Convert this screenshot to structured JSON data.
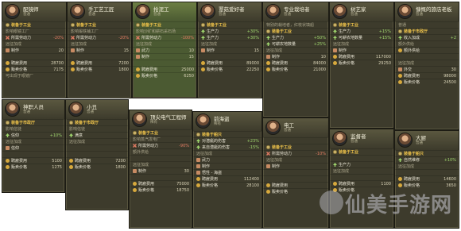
{
  "colors": {
    "card_bg": "#3d3b2c",
    "card_green": "#4b5a32",
    "accent_gold": "#f0c44a",
    "negative": "#e07b62",
    "positive": "#9ed46d"
  },
  "cards": {
    "c1": {
      "title": "配镜师",
      "subtitle": "普通",
      "rows": [
        {
          "icon": "gear",
          "label": "装备于工业",
          "value": ""
        },
        {
          "icon": "",
          "label": "影响眼镜工厂",
          "value": ""
        },
        {
          "icon": "cross",
          "label": "所需劳动力",
          "value": "-20%"
        },
        {
          "icon": "",
          "label": "远征加成",
          "value": ""
        },
        {
          "icon": "fist",
          "label": "制作",
          "value": "20"
        },
        {
          "icon": "",
          "label": "",
          "value": ""
        },
        {
          "icon": "coin",
          "label": "聘雇费用",
          "value": "28700"
        },
        {
          "icon": "coin",
          "label": "贩卖价格",
          "value": "7175"
        },
        {
          "icon": "",
          "label": "可出现于眼镜厂",
          "value": ""
        }
      ]
    },
    "c2": {
      "title": "手工艺工匠",
      "subtitle": "普通",
      "rows": [
        {
          "icon": "gear",
          "label": "装备于工业",
          "value": ""
        },
        {
          "icon": "",
          "label": "影响锻铁铺工厂",
          "value": ""
        },
        {
          "icon": "cross",
          "label": "所需劳动力",
          "value": "-20%"
        },
        {
          "icon": "",
          "label": "远征加成",
          "value": ""
        },
        {
          "icon": "fist",
          "label": "制作",
          "value": "15"
        },
        {
          "icon": "",
          "label": "",
          "value": ""
        },
        {
          "icon": "coin",
          "label": "聘雇费用",
          "value": "7200"
        },
        {
          "icon": "coin",
          "label": "贩卖价格",
          "value": "1800"
        }
      ]
    },
    "c3": {
      "title": "抢泥工",
      "subtitle": "普通",
      "rows": [
        {
          "icon": "gear",
          "label": "装备于工业",
          "value": ""
        },
        {
          "icon": "",
          "label": "影响沙矿和耕石采石场",
          "value": ""
        },
        {
          "icon": "cross",
          "label": "所需劳动力",
          "value": "-100%"
        },
        {
          "icon": "",
          "label": "远征加成",
          "value": ""
        },
        {
          "icon": "fist",
          "label": "武力",
          "value": "10"
        },
        {
          "icon": "fist",
          "label": "制作",
          "value": "15"
        },
        {
          "icon": "",
          "label": "",
          "value": ""
        },
        {
          "icon": "coin",
          "label": "聘雇费用",
          "value": "25000"
        },
        {
          "icon": "coin",
          "label": "贩卖价格",
          "value": "6250"
        }
      ]
    },
    "c4": {
      "title": "蕈菇爱好者",
      "subtitle": "普通",
      "rows": [
        {
          "icon": "gear",
          "label": "装备于工业",
          "value": ""
        },
        {
          "icon": "arrow",
          "label": "生产力",
          "value": "+30%"
        },
        {
          "icon": "arrow",
          "label": "生产力",
          "value": "+30%"
        },
        {
          "icon": "",
          "label": "远征加成",
          "value": ""
        },
        {
          "icon": "fist",
          "label": "制作",
          "value": "15"
        },
        {
          "icon": "",
          "label": "",
          "value": ""
        },
        {
          "icon": "coin",
          "label": "聘雇费用",
          "value": "89000"
        },
        {
          "icon": "coin",
          "label": "贩卖价格",
          "value": "22250"
        }
      ]
    },
    "c5": {
      "title": "专业栽培者",
      "subtitle": "普通",
      "rows": [
        {
          "icon": "",
          "label": "特别的栽培者，红枝状填船",
          "value": ""
        },
        {
          "icon": "gear",
          "label": "装备于工业",
          "value": ""
        },
        {
          "icon": "arrow",
          "label": "生产力",
          "value": "+50%"
        },
        {
          "icon": "arrow",
          "label": "可耕农地数量",
          "value": "+25%"
        },
        {
          "icon": "",
          "label": "远征加成",
          "value": ""
        },
        {
          "icon": "fist",
          "label": "制作",
          "value": "10"
        },
        {
          "icon": "coin",
          "label": "聘雇费用",
          "value": "84000"
        },
        {
          "icon": "coin",
          "label": "贩卖价格",
          "value": "21000"
        }
      ]
    },
    "c6": {
      "title": "树艺家",
      "subtitle": "普通",
      "rows": [
        {
          "icon": "gear",
          "label": "装备于工业",
          "value": ""
        },
        {
          "icon": "arrow",
          "label": "生产力",
          "value": "+15%"
        },
        {
          "icon": "arrow",
          "label": "可耕农地数量",
          "value": "+15%"
        },
        {
          "icon": "",
          "label": "远征加成",
          "value": ""
        },
        {
          "icon": "fist",
          "label": "制作",
          "value": ""
        },
        {
          "icon": "coin",
          "label": "聘雇费用",
          "value": "117000"
        },
        {
          "icon": "coin",
          "label": "贩卖价格",
          "value": "29250"
        }
      ]
    },
    "c7": {
      "title": "慷慨的旅店老板",
      "subtitle": "普通",
      "rows": [
        {
          "icon": "",
          "label": "普通",
          "value": ""
        },
        {
          "icon": "gear",
          "label": "装备于市政厅",
          "value": ""
        },
        {
          "icon": "arrow",
          "label": "收入加成",
          "value": "+2"
        },
        {
          "icon": "",
          "label": "额外供给",
          "value": ""
        },
        {
          "icon": "coin",
          "label": "额外供给",
          "value": ""
        },
        {
          "icon": "",
          "label": "",
          "value": ""
        },
        {
          "icon": "",
          "label": "远征加成",
          "value": ""
        },
        {
          "icon": "fist",
          "label": "外交",
          "value": "30"
        },
        {
          "icon": "coin",
          "label": "聘雇费用",
          "value": "98000"
        },
        {
          "icon": "coin",
          "label": "贩卖价格",
          "value": "24500"
        }
      ]
    },
    "c8": {
      "title": "神职人员",
      "subtitle": "普通",
      "rows": [
        {
          "icon": "gear",
          "label": "装备于市政厅",
          "value": ""
        },
        {
          "icon": "",
          "label": "影响信徒",
          "value": ""
        },
        {
          "icon": "arrow",
          "label": "信仰",
          "value": "+10%"
        },
        {
          "icon": "",
          "label": "远征加成",
          "value": ""
        },
        {
          "icon": "fist",
          "label": "信仰",
          "value": ""
        },
        {
          "icon": "",
          "label": "",
          "value": ""
        },
        {
          "icon": "coin",
          "label": "聘雇费用",
          "value": "5100"
        },
        {
          "icon": "coin",
          "label": "贩卖价格",
          "value": "1275"
        }
      ]
    },
    "c9": {
      "title": "小丑",
      "subtitle": "普通",
      "rows": [
        {
          "icon": "gear",
          "label": "装备于市政厅",
          "value": ""
        },
        {
          "icon": "",
          "label": "影响信徒",
          "value": ""
        },
        {
          "icon": "arrow",
          "label": "满意",
          "value": ""
        },
        {
          "icon": "",
          "label": "远征加成",
          "value": ""
        },
        {
          "icon": "",
          "label": "",
          "value": ""
        },
        {
          "icon": "",
          "label": "",
          "value": ""
        },
        {
          "icon": "coin",
          "label": "聘雇费用",
          "value": "7200"
        },
        {
          "icon": "coin",
          "label": "贩卖价格",
          "value": "1800"
        }
      ]
    },
    "c10": {
      "title": "顶尖电气工程师",
      "subtitle": "稀有",
      "rows": [
        {
          "icon": "gear",
          "label": "装备于工业",
          "value": ""
        },
        {
          "icon": "",
          "label": "影响蒸汽发电厂",
          "value": ""
        },
        {
          "icon": "cross",
          "label": "所需劳动力",
          "value": "-90%"
        },
        {
          "icon": "",
          "label": "额外供给",
          "value": ""
        },
        {
          "icon": "",
          "label": "",
          "value": ""
        },
        {
          "icon": "",
          "label": "远征加成",
          "value": ""
        },
        {
          "icon": "fist",
          "label": "制作",
          "value": "30"
        },
        {
          "icon": "",
          "label": "",
          "value": ""
        },
        {
          "icon": "coin",
          "label": "聘雇费用",
          "value": "75000"
        },
        {
          "icon": "coin",
          "label": "贩卖价格",
          "value": "18750"
        }
      ]
    },
    "c11": {
      "title": "前海盗",
      "subtitle": "稀有",
      "rows": [
        {
          "icon": "gear",
          "label": "装备于船只",
          "value": ""
        },
        {
          "icon": "arrow",
          "label": "对潜艇的伤害",
          "value": "+23%"
        },
        {
          "icon": "arrow",
          "label": "来自潜艇的伤害",
          "value": "-15%"
        },
        {
          "icon": "",
          "label": "远征加成",
          "value": ""
        },
        {
          "icon": "fist",
          "label": "武力",
          "value": ""
        },
        {
          "icon": "fist",
          "label": "制作",
          "value": ""
        },
        {
          "icon": "fist",
          "label": "悟性 - 海盗",
          "value": ""
        },
        {
          "icon": "coin",
          "label": "聘雇费用",
          "value": "112400"
        },
        {
          "icon": "coin",
          "label": "贩卖价格",
          "value": "28100"
        }
      ]
    },
    "c12": {
      "title": "电工",
      "subtitle": "普通",
      "rows": [
        {
          "icon": "",
          "label": "",
          "value": ""
        },
        {
          "icon": "gear",
          "label": "装备于工业",
          "value": ""
        },
        {
          "icon": "cross",
          "label": "所需劳动力",
          "value": "-10%"
        },
        {
          "icon": "",
          "label": "远征加成",
          "value": ""
        },
        {
          "icon": "fist",
          "label": "制作",
          "value": ""
        },
        {
          "icon": "",
          "label": "",
          "value": ""
        },
        {
          "icon": "",
          "label": "",
          "value": ""
        },
        {
          "icon": "coin",
          "label": "聘雇费用",
          "value": ""
        },
        {
          "icon": "coin",
          "label": "贩卖价格",
          "value": ""
        }
      ]
    },
    "c13": {
      "title": "监督者",
      "subtitle": "普通",
      "rows": [
        {
          "icon": "gear",
          "label": "装备于工业",
          "value": ""
        },
        {
          "icon": "",
          "label": "",
          "value": ""
        },
        {
          "icon": "arrow",
          "label": "生产力",
          "value": ""
        },
        {
          "icon": "",
          "label": "远征加成",
          "value": ""
        },
        {
          "icon": "",
          "label": "",
          "value": ""
        },
        {
          "icon": "coin",
          "label": "聘雇费用",
          "value": "1100"
        },
        {
          "icon": "coin",
          "label": "贩卖价格",
          "value": ""
        }
      ]
    },
    "c14": {
      "title": "大厨",
      "subtitle": "普通",
      "rows": [
        {
          "icon": "gear",
          "label": "装备于船只",
          "value": ""
        },
        {
          "icon": "arrow",
          "label": "自然维修",
          "value": "+10%"
        },
        {
          "icon": "",
          "label": "远征加成",
          "value": ""
        },
        {
          "icon": "",
          "label": "",
          "value": ""
        },
        {
          "icon": "coin",
          "label": "聘雇费用",
          "value": "14600"
        },
        {
          "icon": "coin",
          "label": "贩卖价格",
          "value": "3650"
        }
      ]
    }
  },
  "watermark": {
    "text": "仙美手游网"
  }
}
